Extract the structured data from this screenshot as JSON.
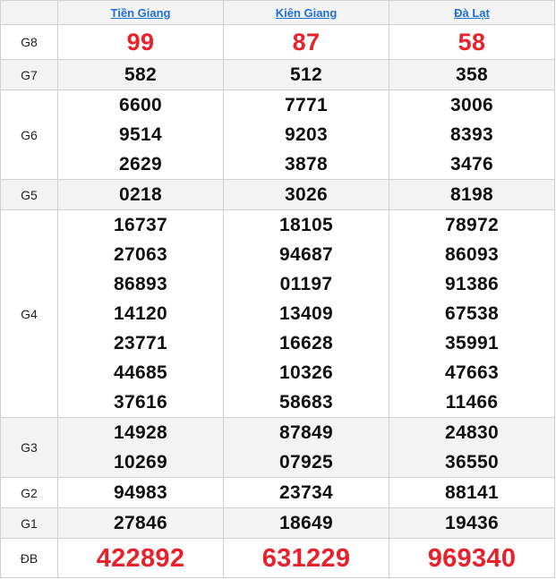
{
  "provinces": [
    "Tiền Giang",
    "Kiên Giang",
    "Đà Lạt"
  ],
  "colors": {
    "accent_link": "#1f6fd6",
    "special_red": "#e8212a",
    "row_alt": "#f3f3f3",
    "border": "#d0d0d0"
  },
  "rows": {
    "g8": {
      "label": "G8",
      "values": [
        [
          "99"
        ],
        [
          "87"
        ],
        [
          "58"
        ]
      ]
    },
    "g7": {
      "label": "G7",
      "values": [
        [
          "582"
        ],
        [
          "512"
        ],
        [
          "358"
        ]
      ]
    },
    "g6": {
      "label": "G6",
      "values": [
        [
          "6600",
          "9514",
          "2629"
        ],
        [
          "7771",
          "9203",
          "3878"
        ],
        [
          "3006",
          "8393",
          "3476"
        ]
      ]
    },
    "g5": {
      "label": "G5",
      "values": [
        [
          "0218"
        ],
        [
          "3026"
        ],
        [
          "8198"
        ]
      ]
    },
    "g4": {
      "label": "G4",
      "values": [
        [
          "16737",
          "27063",
          "86893",
          "14120",
          "23771",
          "44685",
          "37616"
        ],
        [
          "18105",
          "94687",
          "01197",
          "13409",
          "16628",
          "10326",
          "58683"
        ],
        [
          "78972",
          "86093",
          "91386",
          "67538",
          "35991",
          "47663",
          "11466"
        ]
      ]
    },
    "g3": {
      "label": "G3",
      "values": [
        [
          "14928",
          "10269"
        ],
        [
          "87849",
          "07925"
        ],
        [
          "24830",
          "36550"
        ]
      ]
    },
    "g2": {
      "label": "G2",
      "values": [
        [
          "94983"
        ],
        [
          "23734"
        ],
        [
          "88141"
        ]
      ]
    },
    "g1": {
      "label": "G1",
      "values": [
        [
          "27846"
        ],
        [
          "18649"
        ],
        [
          "19436"
        ]
      ]
    },
    "db": {
      "label": "ĐB",
      "values": [
        [
          "422892"
        ],
        [
          "631229"
        ],
        [
          "969340"
        ]
      ]
    }
  }
}
